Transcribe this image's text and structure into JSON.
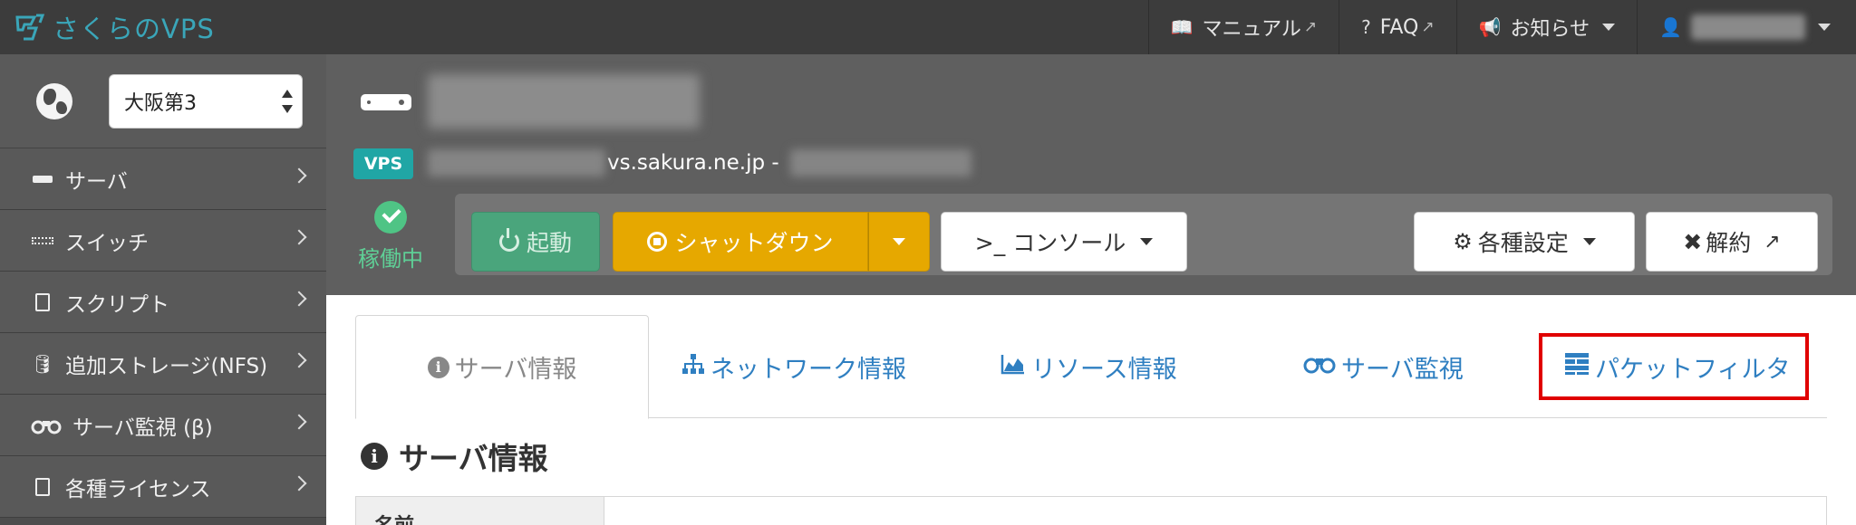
{
  "app": {
    "logo_text": "さくらのVPS",
    "brand_color": "#3aa6b9"
  },
  "topnav": {
    "manual_label": "マニュアル",
    "faq_label": "FAQ",
    "news_label": "お知らせ"
  },
  "sidebar": {
    "region_select": {
      "selected": "大阪第3"
    },
    "items": [
      {
        "label": "サーバ",
        "icon": "server-icon"
      },
      {
        "label": "スイッチ",
        "icon": "switch-icon"
      },
      {
        "label": "スクリプト",
        "icon": "script-icon"
      },
      {
        "label": "追加ストレージ(NFS)",
        "icon": "database-icon"
      },
      {
        "label": "サーバ監視 (β)",
        "icon": "binoculars-icon"
      },
      {
        "label": "各種ライセンス",
        "icon": "document-icon"
      }
    ]
  },
  "server": {
    "badge": "VPS",
    "host_suffix": "vs.sakura.ne.jp -",
    "status": "稼働中",
    "status_color": "#4fc485"
  },
  "toolbar": {
    "start_label": "起動",
    "shutdown_label": "シャットダウン",
    "console_label": ">_ コンソール",
    "settings_label": "各種設定",
    "cancel_label": "解約"
  },
  "tabs": [
    {
      "label": "サーバ情報",
      "icon": "info-icon",
      "active": true
    },
    {
      "label": "ネットワーク情報",
      "icon": "network-icon",
      "active": false
    },
    {
      "label": "リソース情報",
      "icon": "area-chart-icon",
      "active": false
    },
    {
      "label": "サーバ監視",
      "icon": "binoculars-icon",
      "active": false
    },
    {
      "label": "パケットフィルタ",
      "icon": "firewall-icon",
      "active": false
    }
  ],
  "section": {
    "title": "サーバ情報",
    "first_row_label": "名前"
  },
  "colors": {
    "accent": "#2f7fc1",
    "shutdown": "#e6a800",
    "start": "#4aa57c",
    "highlight": "#e00000"
  }
}
